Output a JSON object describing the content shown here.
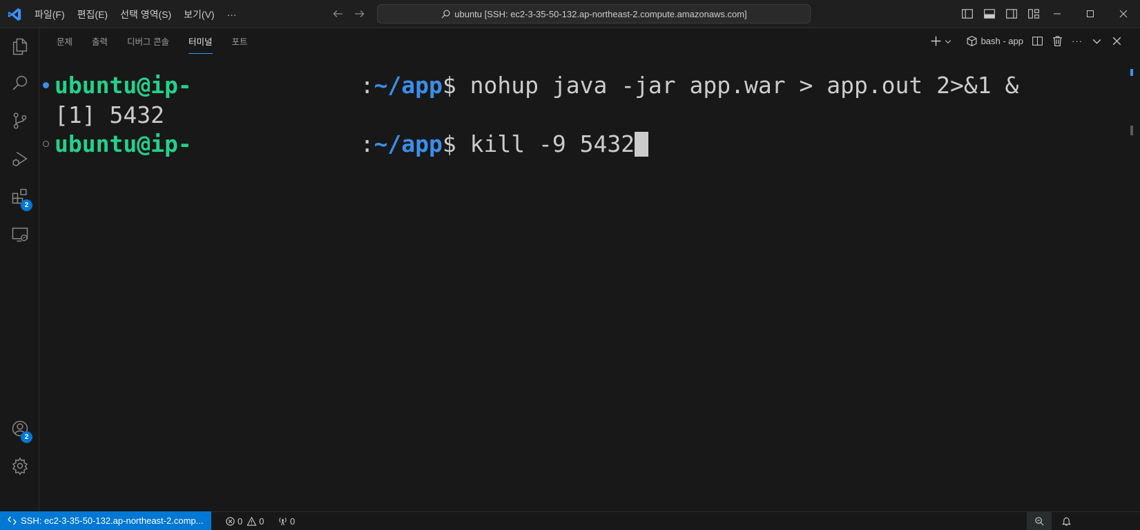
{
  "menu": {
    "file": "파일(F)",
    "edit": "편집(E)",
    "selection": "선택 영역(S)",
    "view": "보기(V)",
    "more": "···"
  },
  "command_center": {
    "text": "ubuntu [SSH: ec2-3-35-50-132.ap-northeast-2.compute.amazonaws.com]"
  },
  "activity_bar": {
    "extensions_badge": "2",
    "accounts_badge": "2"
  },
  "panel": {
    "tabs": [
      "문제",
      "출력",
      "디버그 콘솔",
      "터미널",
      "포트"
    ],
    "active_tab": "터미널",
    "terminal_name": "bash - app"
  },
  "terminal": {
    "lines": [
      {
        "user": "ubuntu@ip-",
        "sep": ":",
        "path": "~/app",
        "prompt": "$ ",
        "command": "nohup java -jar app.war > app.out 2>&1 &"
      },
      {
        "output": "[1] 5432"
      },
      {
        "user": "ubuntu@ip-",
        "sep": ":",
        "path": "~/app",
        "prompt": "$ ",
        "command": "kill -9 5432"
      }
    ]
  },
  "status": {
    "remote": "SSH: ec2-3-35-50-132.ap-northeast-2.comp...",
    "errors": "0",
    "warnings": "0",
    "ports": "0"
  },
  "colors": {
    "accent": "#0078d4",
    "user_green": "#23d18b",
    "path_blue": "#3b8eea",
    "background": "#181818"
  }
}
